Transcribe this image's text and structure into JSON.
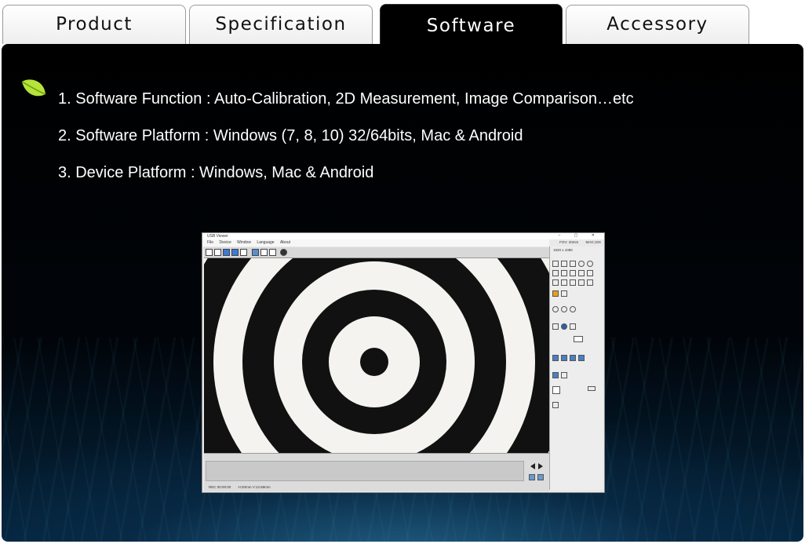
{
  "tabs": [
    {
      "label": "Product"
    },
    {
      "label": "Specification"
    },
    {
      "label": "Software"
    },
    {
      "label": "Accessory"
    }
  ],
  "active_tab": "Software",
  "features": [
    "1. Software Function : Auto-Calibration, 2D Measurement, Image Comparison…etc",
    "2. Software Platform : Windows (7, 8, 10) 32/64bits, Mac & Android",
    "3. Device Platform : Windows, Mac & Android"
  ],
  "app": {
    "title": "USB Viewer",
    "menu": [
      "File",
      "Device",
      "Window",
      "Language",
      "About"
    ],
    "fov": "FOV: 20mm",
    "mag": "MAG:10X",
    "resolution": "1920 x 1080",
    "status": [
      "REC 00:00:00",
      "H:20mm  V:13.68mm"
    ]
  },
  "colors": {
    "panel_bg": "#000000",
    "accent_blue": "#1a5f8a",
    "leaf_green": "#b6e33a"
  }
}
